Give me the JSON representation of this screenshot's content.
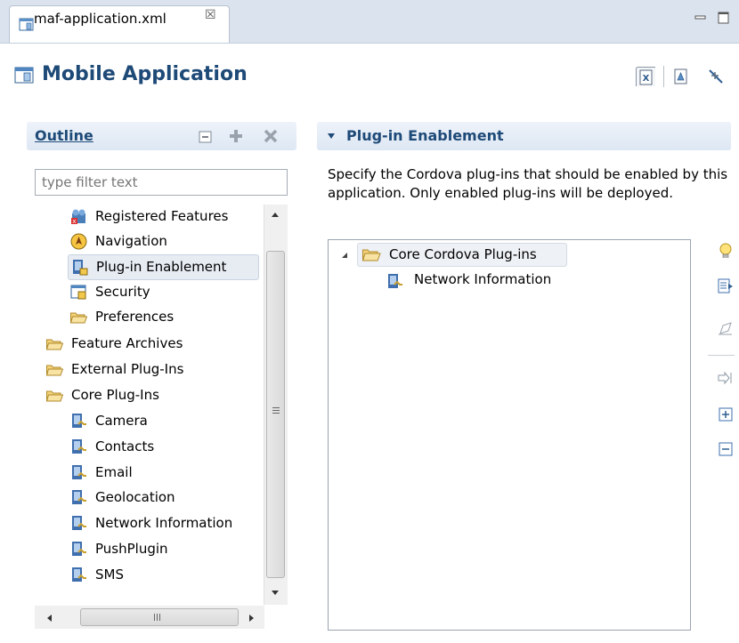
{
  "tab": {
    "label": "maf-application.xml",
    "close": "☒",
    "icon": "mobile-app-file-icon"
  },
  "window_buttons": [
    "minimize",
    "maximize"
  ],
  "header": {
    "title": "Mobile Application",
    "icon": "mobile-app-icon",
    "toolbar": [
      "xml-source-icon",
      "overview-icon",
      "disconnect-icon"
    ]
  },
  "outline": {
    "title": "Outline",
    "toolbar": [
      "collapse-all-icon",
      "add-icon",
      "delete-icon"
    ],
    "filter_placeholder": "type filter text",
    "items": [
      {
        "label": "Registered Features",
        "icon": "features-icon",
        "level": 1
      },
      {
        "label": "Navigation",
        "icon": "navigation-icon",
        "level": 1
      },
      {
        "label": "Plug-in Enablement",
        "icon": "plugin-enablement-icon",
        "level": 1,
        "selected": true
      },
      {
        "label": "Security",
        "icon": "security-icon",
        "level": 1
      },
      {
        "label": "Preferences",
        "icon": "folder-icon",
        "level": 1
      },
      {
        "label": "Feature Archives",
        "icon": "folder-icon",
        "level": 0
      },
      {
        "label": "External Plug-Ins",
        "icon": "folder-icon",
        "level": 0
      },
      {
        "label": "Core Plug-Ins",
        "icon": "folder-icon",
        "level": 0
      },
      {
        "label": "Camera",
        "icon": "plugin-icon",
        "level": 1
      },
      {
        "label": "Contacts",
        "icon": "plugin-icon",
        "level": 1
      },
      {
        "label": "Email",
        "icon": "plugin-icon",
        "level": 1
      },
      {
        "label": "Geolocation",
        "icon": "plugin-icon",
        "level": 1
      },
      {
        "label": "Network Information",
        "icon": "plugin-icon",
        "level": 1
      },
      {
        "label": "PushPlugin",
        "icon": "plugin-icon",
        "level": 1
      },
      {
        "label": "SMS",
        "icon": "plugin-icon",
        "level": 1
      }
    ]
  },
  "plugin_section": {
    "title": "Plug-in Enablement",
    "description": "Specify the Cordova plug-ins that should be enabled by this application.  Only enabled plug-ins will be deployed.",
    "tree": [
      {
        "label": "Core Cordova Plug-ins",
        "icon": "folder-icon",
        "expanded": true,
        "children": [
          {
            "label": "Network Information",
            "icon": "plugin-icon"
          }
        ]
      }
    ],
    "side_toolbar": [
      "lightbulb-icon",
      "add-plugin-icon",
      "edit-icon",
      "enable-icon",
      "expand-all-icon",
      "collapse-all-icon"
    ]
  }
}
